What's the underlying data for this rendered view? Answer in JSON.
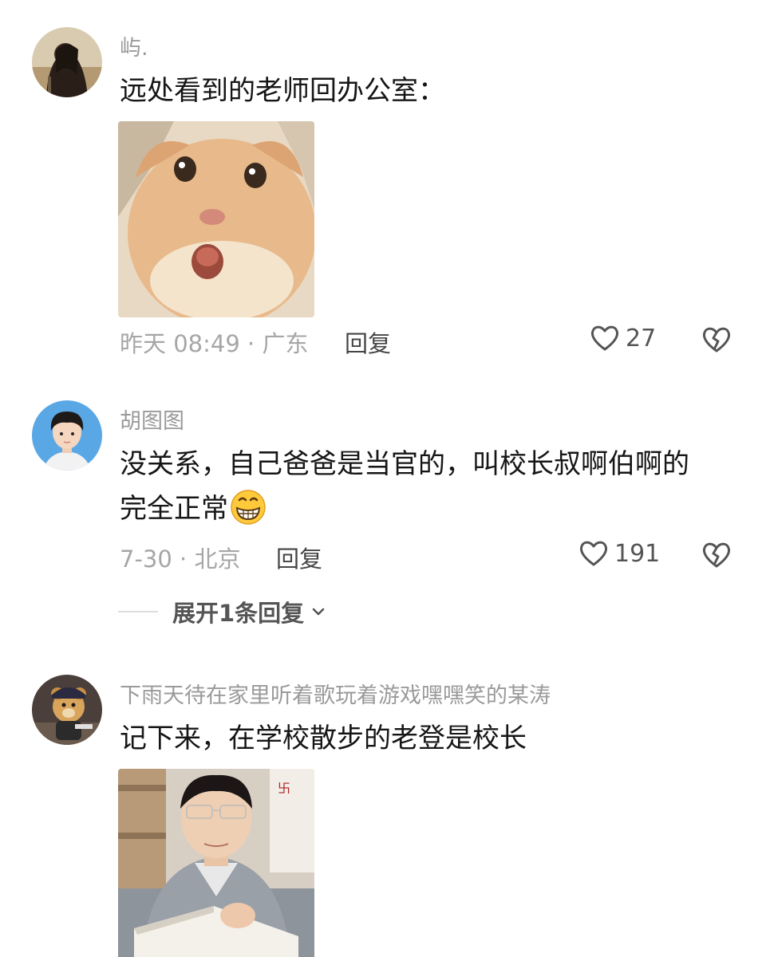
{
  "comments": [
    {
      "username": "屿.",
      "text": "远处看到的老师回办公室：",
      "time_location": "昨天 08:49 · 广东",
      "reply_label": "回复",
      "like_count": "27",
      "image": "cat-surprised-face"
    },
    {
      "username": "胡图图",
      "text_line1": "没关系，自己爸爸是当官的，叫校长叔啊伯啊的",
      "text_line2": "完全正常",
      "emoji": "grinning-face-emoji",
      "time_location": "7-30 · 北京",
      "reply_label": "回复",
      "like_count": "191",
      "expand_label": "展开1条回复"
    },
    {
      "username": "下雨天待在家里听着歌玩着游戏嘿嘿笑的某涛",
      "text": "记下来，在学校散步的老登是校长",
      "image": "man-reading-book-photo"
    }
  ],
  "icons": [
    "heart-outline-icon",
    "broken-heart-icon",
    "chevron-down-icon"
  ],
  "colors": {
    "username": "#9a9a9a",
    "body_text": "#161616",
    "meta": "#a6a6a6",
    "action": "#555555"
  }
}
